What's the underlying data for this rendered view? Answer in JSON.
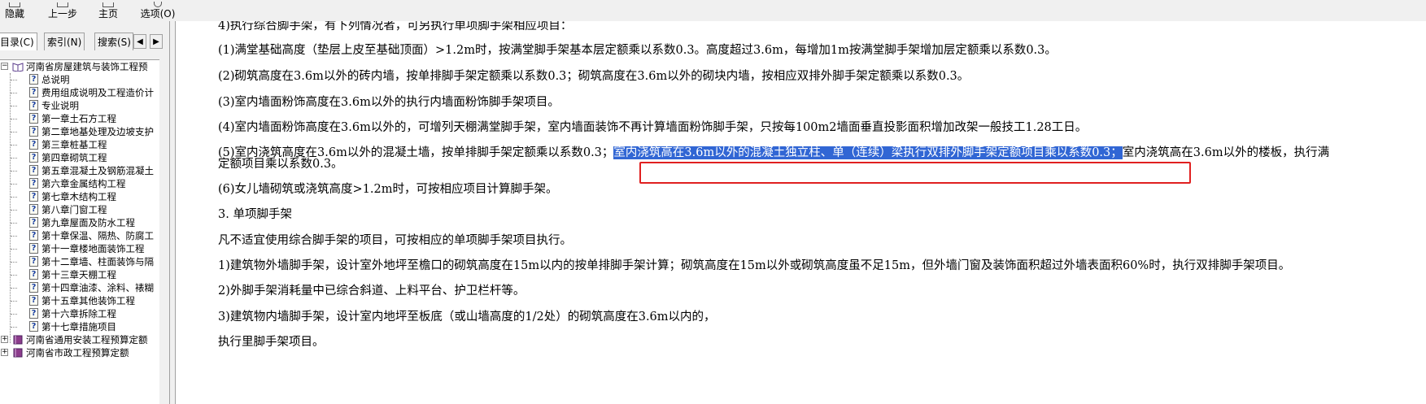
{
  "toolbar": {
    "items": [
      {
        "label": "隐藏"
      },
      {
        "label": "上一步"
      },
      {
        "label": "主页"
      },
      {
        "label": "选项(O)"
      }
    ]
  },
  "tabs": [
    {
      "label": "目录(C)"
    },
    {
      "label": "索引(N)"
    },
    {
      "label": "搜索(S)"
    }
  ],
  "tree": {
    "root": "河南省房屋建筑与装饰工程预",
    "children": [
      "总说明",
      "费用组成说明及工程造价计",
      "专业说明",
      "第一章土石方工程",
      "第二章地基处理及边坡支护",
      "第三章桩基工程",
      "第四章砌筑工程",
      "第五章混凝土及钢筋混凝土",
      "第六章金属结构工程",
      "第七章木结构工程",
      "第八章门窗工程",
      "第九章屋面及防水工程",
      "第十章保温、隔热、防腐工",
      "第十一章楼地面装饰工程",
      "第十二章墙、柱面装饰与隔",
      "第十三章天棚工程",
      "第十四章油漆、涂料、裱糊",
      "第十五章其他装饰工程",
      "第十六章拆除工程",
      "第十七章措施项目"
    ],
    "siblings": [
      "河南省通用安装工程预算定额",
      "河南省市政工程预算定额"
    ]
  },
  "content": {
    "line0": "4)执行综合脚手架，有下列情况者，可另执行单项脚手架相应项目：",
    "p1": "(1)满堂基础高度（垫层上皮至基础顶面）>1.2m时，按满堂脚手架基本层定额乘以系数0.3。高度超过3.6m，每增加1m按满堂脚手架增加层定额乘以系数0.3。",
    "p2": "(2)砌筑高度在3.6m以外的砖内墙，按单排脚手架定额乘以系数0.3；砌筑高度在3.6m以外的砌块内墙，按相应双排外脚手架定额乘以系数0.3。",
    "p3": "(3)室内墙面粉饰高度在3.6m以外的执行内墙面粉饰脚手架项目。",
    "p4": "(4)室内墙面粉饰高度在3.6m以外的，可增列天棚满堂脚手架，室内墙面装饰不再计算墙面粉饰脚手架，只按每100m2墙面垂直投影面积增加改架一般技工1.28工日。",
    "p5_before": "(5)室内浇筑高度在3.6m以外的混凝土墙，按单排脚手架定额乘以系数0.3；",
    "p5_highlight": "室内浇筑高在3.6m以外的混凝土独立柱、单（连续）梁执行双排外脚手架定额项目乘以系数0.3；",
    "p5_after": "室内浇筑高在3.6m以外的楼板，执行满",
    "p5_line2": "定额项目乘以系数0.3。",
    "p6": "(6)女儿墙砌筑或浇筑高度>1.2m时，可按相应项目计算脚手架。",
    "h3": "3. 单项脚手架",
    "p7": "凡不适宜使用综合脚手架的项目，可按相应的单项脚手架项目执行。",
    "p8": "1)建筑物外墙脚手架，设计室外地坪至檐口的砌筑高度在15m以内的按单排脚手架计算；砌筑高度在15m以外或砌筑高度虽不足15m，但外墙门窗及装饰面积超过外墙表面积60%时，执行双排脚手架项目。",
    "p9": "2)外脚手架消耗量中已综合斜道、上料平台、护卫栏杆等。",
    "p10": "3)建筑物内墙脚手架，设计室内地坪至板底（或山墙高度的1/2处）的砌筑高度在3.6m以内的，",
    "p11": "执行里脚手架项目。"
  }
}
